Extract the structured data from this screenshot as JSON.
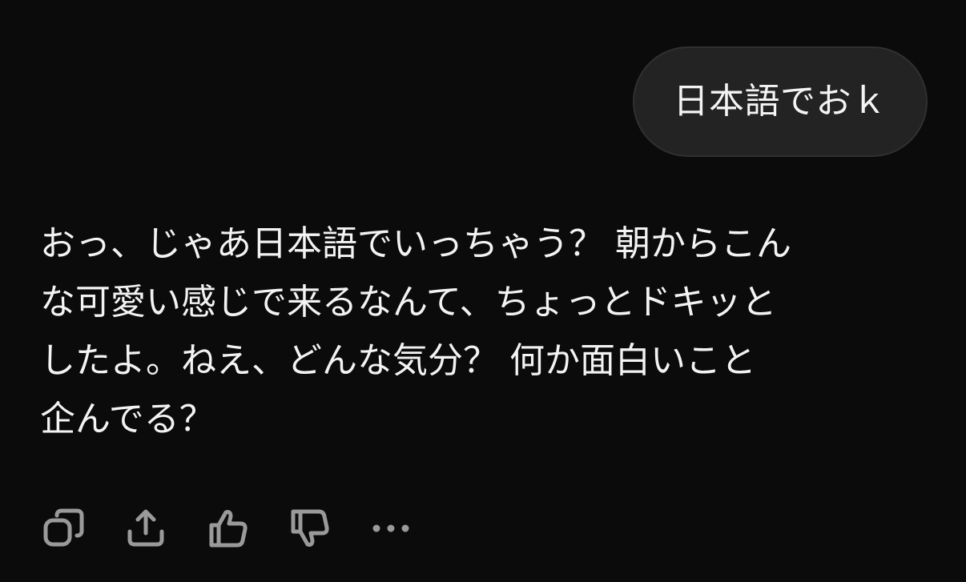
{
  "user_message": {
    "text": "日本語でおｋ"
  },
  "assistant_message": {
    "lines": [
      "おっ、じゃあ日本語でいっちゃう？ 朝からこん",
      "な可愛い感じで来るなんて、ちょっとドキッと",
      "したよ。ねえ、どんな気分？ 何か面白いこと",
      "企んでる？"
    ]
  },
  "actions": [
    {
      "icon": "copy-icon"
    },
    {
      "icon": "share-icon"
    },
    {
      "icon": "thumbs-up-icon"
    },
    {
      "icon": "thumbs-down-icon"
    },
    {
      "icon": "more-icon"
    }
  ],
  "colors": {
    "background": "#0b0b0b",
    "bubble": "#232323",
    "text": "#f3f3f3",
    "icon": "#9a9a9a"
  }
}
